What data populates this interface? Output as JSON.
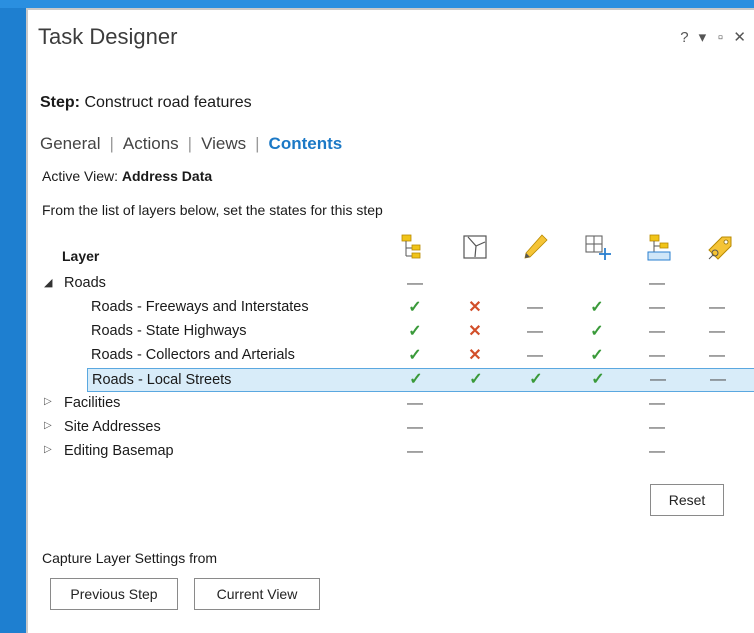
{
  "window": {
    "title": "Task Designer",
    "controls": [
      "?",
      "▾",
      "▫",
      "✕"
    ]
  },
  "step": {
    "label": "Step:",
    "name": "Construct road features"
  },
  "tabs": [
    {
      "label": "General",
      "active": false
    },
    {
      "label": "Actions",
      "active": false
    },
    {
      "label": "Views",
      "active": false
    },
    {
      "label": "Contents",
      "active": true
    }
  ],
  "active_view": {
    "label": "Active View:",
    "value": "Address Data"
  },
  "instructions": "From the list of layers below, set the states for this step",
  "table": {
    "layer_header": "Layer",
    "state_icons": [
      "visibility-icon",
      "selectable-icon",
      "editable-icon",
      "snappable-icon",
      "layer-properties-icon",
      "labels-icon"
    ],
    "rows": [
      {
        "label": "Roads",
        "type": "group",
        "expanded": true,
        "states": [
          "dash",
          "",
          "",
          "",
          "dash",
          ""
        ]
      },
      {
        "label": "Roads - Freeways and Interstates",
        "type": "child",
        "states": [
          "check",
          "x",
          "dash",
          "check",
          "dash",
          "dash"
        ]
      },
      {
        "label": "Roads - State Highways",
        "type": "child",
        "states": [
          "check",
          "x",
          "dash",
          "check",
          "dash",
          "dash"
        ]
      },
      {
        "label": "Roads - Collectors and Arterials",
        "type": "child",
        "states": [
          "check",
          "x",
          "dash",
          "check",
          "dash",
          "dash"
        ]
      },
      {
        "label": "Roads - Local Streets",
        "type": "child",
        "selected": true,
        "states": [
          "check",
          "check",
          "check",
          "check",
          "dash",
          "dash"
        ]
      },
      {
        "label": "Facilities",
        "type": "group",
        "expanded": false,
        "states": [
          "dash",
          "",
          "",
          "",
          "dash",
          ""
        ]
      },
      {
        "label": "Site Addresses",
        "type": "group",
        "expanded": false,
        "states": [
          "dash",
          "",
          "",
          "",
          "dash",
          ""
        ]
      },
      {
        "label": "Editing Basemap",
        "type": "group",
        "expanded": false,
        "states": [
          "dash",
          "",
          "",
          "",
          "dash",
          ""
        ]
      }
    ]
  },
  "buttons": {
    "reset": "Reset",
    "previous_step": "Previous Step",
    "current_view": "Current View"
  },
  "capture_label": "Capture Layer Settings from",
  "colors": {
    "accent": "#1c79c6",
    "check": "#3a9a3a",
    "cross": "#d24f2a",
    "selection_bg": "#d8ecf9",
    "selection_border": "#5aa8e0",
    "desktop": "#1e7fd0"
  }
}
